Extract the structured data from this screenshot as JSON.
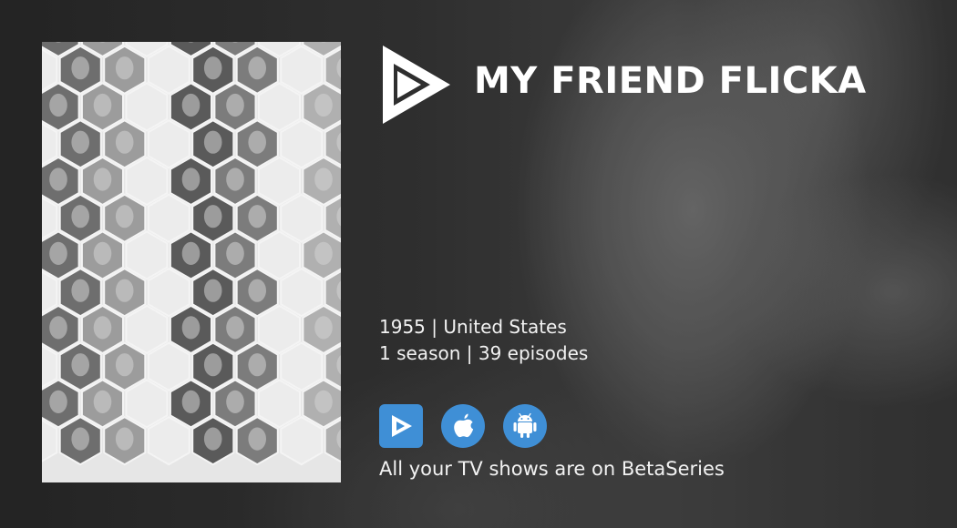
{
  "show": {
    "title": "MY FRIEND FLICKA",
    "year_country": "1955 | United States",
    "seasons_episodes": "1 season | 39 episodes"
  },
  "brand": {
    "logo_icon": "betaseries-play-logo-icon",
    "tagline": "All your TV shows are on BetaSeries"
  },
  "apps": [
    {
      "name": "betaseries-app",
      "icon": "play-icon"
    },
    {
      "name": "ios-app",
      "icon": "apple-icon"
    },
    {
      "name": "android-app",
      "icon": "android-icon"
    }
  ],
  "colors": {
    "accent": "#3f8fd6",
    "text": "#ffffff"
  }
}
